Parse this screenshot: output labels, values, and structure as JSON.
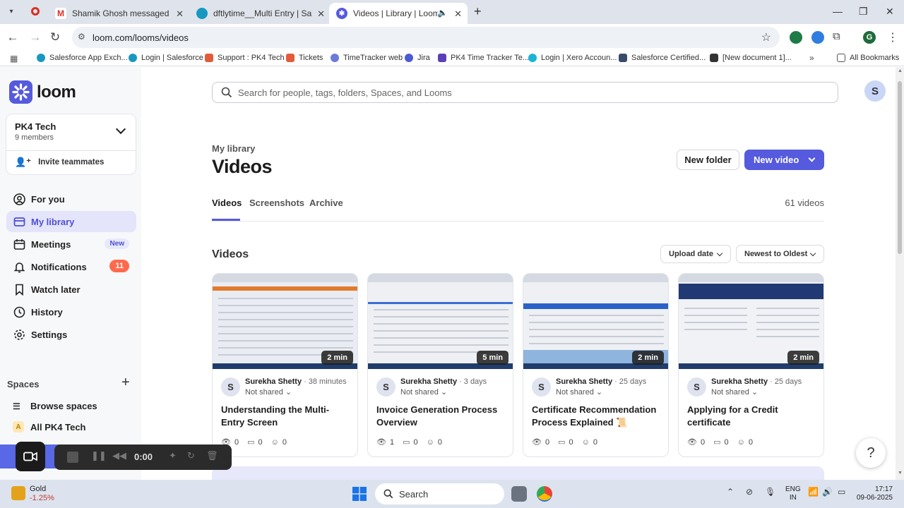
{
  "browser": {
    "tabs": [
      {
        "title": "Shamik Ghosh messaged you -",
        "icon": "gmail-icon"
      },
      {
        "title": "dftlytime__Multi Entry | Salesfor",
        "icon": "salesforce-icon"
      },
      {
        "title": "Videos | Library | Loom",
        "icon": "loom-icon"
      }
    ],
    "url": "loom.com/looms/videos",
    "bookmarks": [
      "Salesforce App Exch...",
      "Login | Salesforce",
      "Support : PK4 Tech",
      "Tickets",
      "TimeTracker web",
      "Jira",
      "PK4 Time Tracker Te...",
      "Login | Xero Accoun...",
      "Salesforce Certified...",
      "[New document 1]...",
      "All Bookmarks"
    ],
    "profile_initial": "G"
  },
  "sidebar": {
    "logo": "loom",
    "workspace": {
      "name": "PK4 Tech",
      "members": "9 members",
      "invite": "Invite teammates"
    },
    "nav": [
      {
        "label": "For you",
        "icon": "user-icon"
      },
      {
        "label": "My library",
        "icon": "library-icon",
        "active": true
      },
      {
        "label": "Meetings",
        "icon": "calendar-icon",
        "badge": "New"
      },
      {
        "label": "Notifications",
        "icon": "bell-icon",
        "badge": "11"
      },
      {
        "label": "Watch later",
        "icon": "bookmark-icon"
      },
      {
        "label": "History",
        "icon": "history-icon"
      },
      {
        "label": "Settings",
        "icon": "gear-icon"
      }
    ],
    "spaces": {
      "header": "Spaces",
      "items": [
        {
          "label": "Browse spaces",
          "icon": "list-icon"
        },
        {
          "label": "All PK4 Tech",
          "icon": "space-a-icon",
          "initial": "A"
        }
      ]
    }
  },
  "main": {
    "search_placeholder": "Search for people, tags, folders, Spaces, and Looms",
    "user_initial": "S",
    "breadcrumb": "My library",
    "title": "Videos",
    "new_folder": "New folder",
    "new_video": "New video",
    "tabs": [
      "Videos",
      "Screenshots",
      "Archive"
    ],
    "count": "61 videos",
    "section_title": "Videos",
    "sort_field": "Upload date",
    "sort_order": "Newest to Oldest",
    "videos": [
      {
        "duration": "2 min",
        "author": "Surekha Shetty",
        "ago": "38 minutes",
        "sharing": "Not shared",
        "title": "Understanding the Multi-Entry Screen",
        "views": "0",
        "comments": "0",
        "reactions": "0"
      },
      {
        "duration": "5 min",
        "author": "Surekha Shetty",
        "ago": "3 days",
        "sharing": "Not shared",
        "title": "Invoice Generation Process Overview",
        "views": "1",
        "comments": "0",
        "reactions": "0"
      },
      {
        "duration": "2 min",
        "author": "Surekha Shetty",
        "ago": "25 days",
        "sharing": "Not shared",
        "title": "Certificate Recommendation Process Explained 📜",
        "views": "0",
        "comments": "0",
        "reactions": "0"
      },
      {
        "duration": "2 min",
        "author": "Surekha Shetty",
        "ago": "25 days",
        "sharing": "Not shared",
        "title": "Applying for a Credit certificate",
        "views": "0",
        "comments": "0",
        "reactions": "0"
      }
    ],
    "author_initial": "S",
    "help": "?"
  },
  "recorder": {
    "time": "0:00"
  },
  "taskbar": {
    "ticker_name": "Gold",
    "ticker_change": "-1.25%",
    "search": "Search",
    "lang": "ENG",
    "region": "IN",
    "time": "17:17",
    "date": "09-06-2025"
  },
  "colors": {
    "accent": "#565add",
    "active_bg": "#e4e4fb",
    "badge": "#ff6a4d"
  }
}
